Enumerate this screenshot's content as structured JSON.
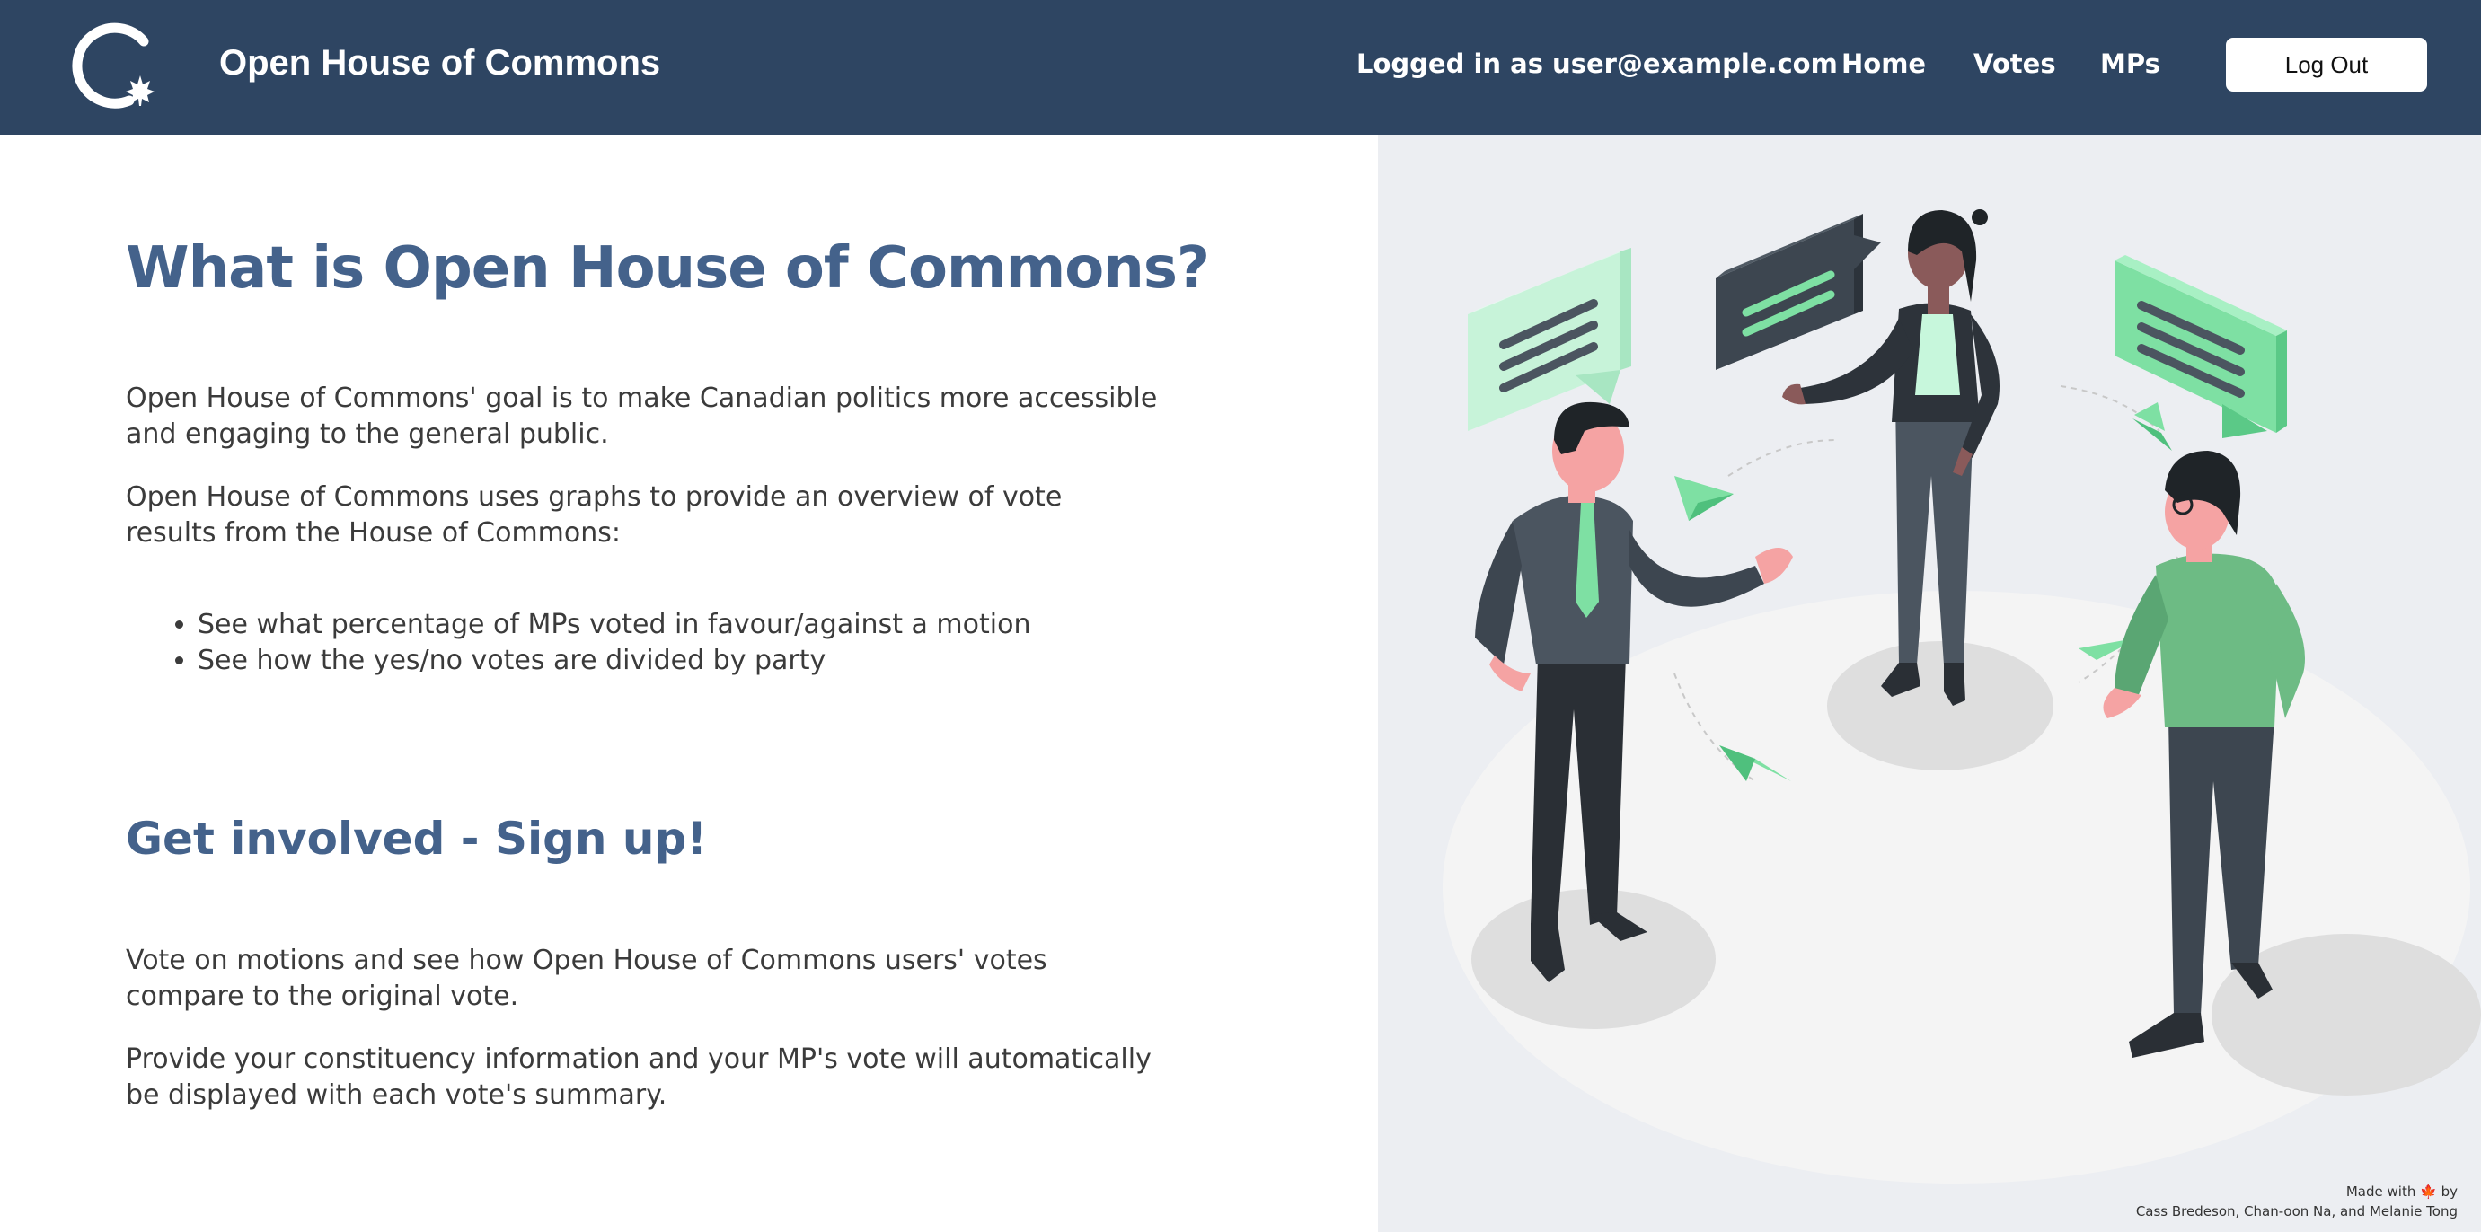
{
  "navbar": {
    "brand": "Open House of Commons",
    "user_status": "Logged in as user@example.com",
    "links": [
      "Home",
      "Votes",
      "MPs"
    ],
    "logout_label": "Log Out",
    "logo_icon": "circle-maple-leaf-logo",
    "colors": {
      "bar": "#2e4562",
      "text": "#ffffff"
    }
  },
  "main": {
    "title": "What is Open House of Commons?",
    "intro_1": "Open House of Commons' goal is to make Canadian politics more accessible and engaging to the general public.",
    "intro_2": "Open House of Commons uses graphs to provide an overview of vote results from the House of Commons:",
    "features": [
      "See what percentage of MPs voted in favour/against a motion",
      "See how the yes/no votes are divided by party"
    ],
    "signup_heading": "Get involved - Sign up!",
    "signup_1": "Vote on motions and see how Open House of Commons users' votes compare to the original vote.",
    "signup_2": "Provide your constituency information and your MP's vote will automatically be displayed with each vote's summary.",
    "heading_color": "#44628b"
  },
  "footer": {
    "made_with": "Made with",
    "heart_icon": "maple-leaf-icon",
    "by": "by",
    "authors": "Cass Bredeson, Chan-oon Na, and Melanie Tong"
  }
}
